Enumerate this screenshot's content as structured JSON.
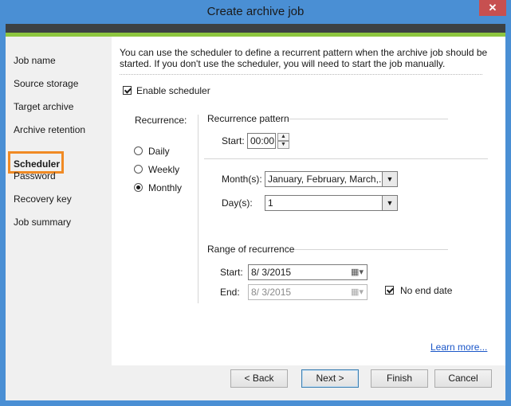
{
  "window": {
    "title": "Create archive job",
    "close_glyph": "✕"
  },
  "nav": {
    "items": [
      {
        "label": "Job name"
      },
      {
        "label": "Source storage"
      },
      {
        "label": "Target archive"
      },
      {
        "label": "Archive retention"
      },
      {
        "label": "Scheduler"
      },
      {
        "label": "Password"
      },
      {
        "label": "Recovery key"
      },
      {
        "label": "Job summary"
      }
    ],
    "active": "Scheduler"
  },
  "intro_text": "You can use the scheduler to define a recurrent pattern when the archive job should be started. If you don't use the scheduler, you will need to start the job manually.",
  "enable_scheduler": {
    "label": "Enable scheduler",
    "checked": true
  },
  "recurrence": {
    "label": "Recurrence:",
    "options": [
      {
        "label": "Daily",
        "selected": false
      },
      {
        "label": "Weekly",
        "selected": false
      },
      {
        "label": "Monthly",
        "selected": true
      }
    ]
  },
  "pattern": {
    "heading": "Recurrence pattern",
    "start_label": "Start:",
    "start_value": "00:00",
    "months_label": "Month(s):",
    "months_value": "January, February, March,...",
    "days_label": "Day(s):",
    "days_value": "1"
  },
  "range": {
    "heading": "Range of recurrence",
    "start_label": "Start:",
    "start_value": "8/  3/2015",
    "end_label": "End:",
    "end_value": "8/  3/2015",
    "no_end_label": "No end date",
    "no_end_checked": true
  },
  "learn_more": "Learn more...",
  "buttons": {
    "back": "< Back",
    "next": "Next >",
    "finish": "Finish",
    "cancel": "Cancel"
  },
  "icons": {
    "up_arrow": "▲",
    "down_arrow": "▼",
    "calendar": "▦"
  },
  "colors": {
    "frame": "#4a8fd4",
    "band_dark": "#3c4144",
    "band_green": "#8dc63f",
    "highlight": "#f08a24",
    "link": "#1a56c8"
  }
}
